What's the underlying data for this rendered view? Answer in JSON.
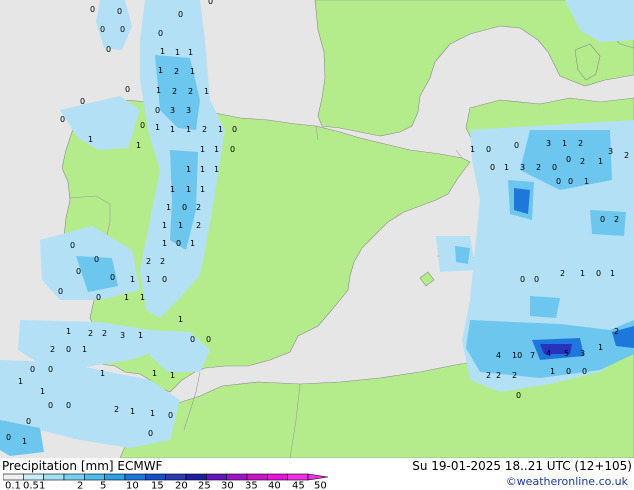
{
  "map": {
    "colors": {
      "sea": "#e6e6e6",
      "land_model": "#b4ec8c",
      "land_outside": "#f2f2f2",
      "border": "#a0a0a0",
      "precip_light": "#b3e0f5",
      "precip_mid": "#6cc6ee",
      "precip_high": "#1e78dc",
      "precip_peak": "#2832be"
    },
    "station_values": [
      {
        "v": "0"
      },
      {
        "v": "0"
      },
      {
        "v": "0"
      },
      {
        "v": "0"
      },
      {
        "v": "0"
      },
      {
        "v": "0"
      },
      {
        "v": "0"
      },
      {
        "v": "0"
      },
      {
        "v": "1"
      },
      {
        "v": "1"
      },
      {
        "v": "1"
      },
      {
        "v": "1"
      },
      {
        "v": "2"
      },
      {
        "v": "1"
      },
      {
        "v": "1"
      },
      {
        "v": "2"
      },
      {
        "v": "2"
      },
      {
        "v": "1"
      },
      {
        "v": "0"
      },
      {
        "v": "3"
      },
      {
        "v": "3"
      },
      {
        "v": "0"
      },
      {
        "v": "2"
      },
      {
        "v": "1"
      },
      {
        "v": "1"
      },
      {
        "v": "1"
      },
      {
        "v": "1"
      },
      {
        "v": "0"
      },
      {
        "v": "0"
      },
      {
        "v": "1"
      },
      {
        "v": "1"
      },
      {
        "v": "0"
      },
      {
        "v": "1"
      },
      {
        "v": "1"
      },
      {
        "v": "1"
      },
      {
        "v": "1"
      },
      {
        "v": "1"
      },
      {
        "v": "1"
      },
      {
        "v": "1"
      },
      {
        "v": "0"
      },
      {
        "v": "0"
      },
      {
        "v": "0"
      },
      {
        "v": "1"
      },
      {
        "v": "1"
      },
      {
        "v": "2"
      },
      {
        "v": "1"
      },
      {
        "v": "1"
      },
      {
        "v": "2"
      },
      {
        "v": "1"
      },
      {
        "v": "0"
      },
      {
        "v": "1"
      },
      {
        "v": "2"
      },
      {
        "v": "2"
      },
      {
        "v": "1"
      },
      {
        "v": "1"
      },
      {
        "v": "0"
      },
      {
        "v": "0"
      },
      {
        "v": "0"
      },
      {
        "v": "0"
      },
      {
        "v": "0"
      },
      {
        "v": "1"
      },
      {
        "v": "1"
      },
      {
        "v": "0"
      },
      {
        "v": "0"
      },
      {
        "v": "1"
      },
      {
        "v": "2"
      },
      {
        "v": "2"
      },
      {
        "v": "3"
      },
      {
        "v": "1"
      },
      {
        "v": "2"
      },
      {
        "v": "0"
      },
      {
        "v": "1"
      },
      {
        "v": "1"
      },
      {
        "v": "0"
      },
      {
        "v": "0"
      },
      {
        "v": "0"
      },
      {
        "v": "0"
      },
      {
        "v": "1"
      },
      {
        "v": "1"
      },
      {
        "v": "1"
      },
      {
        "v": "1"
      },
      {
        "v": "1"
      },
      {
        "v": "0"
      },
      {
        "v": "0"
      },
      {
        "v": "2"
      },
      {
        "v": "1"
      },
      {
        "v": "1"
      },
      {
        "v": "0"
      },
      {
        "v": "0"
      },
      {
        "v": "0"
      },
      {
        "v": "0"
      },
      {
        "v": "1"
      },
      {
        "v": "1"
      },
      {
        "v": "0"
      },
      {
        "v": "0"
      },
      {
        "v": "3"
      },
      {
        "v": "1"
      },
      {
        "v": "2"
      },
      {
        "v": "0"
      },
      {
        "v": "1"
      },
      {
        "v": "3"
      },
      {
        "v": "2"
      },
      {
        "v": "0"
      },
      {
        "v": "0"
      },
      {
        "v": "4"
      },
      {
        "v": "10"
      },
      {
        "v": "7"
      },
      {
        "v": "4"
      },
      {
        "v": "5"
      },
      {
        "v": "3"
      },
      {
        "v": "2"
      },
      {
        "v": "2"
      },
      {
        "v": "2"
      },
      {
        "v": "0"
      },
      {
        "v": "1"
      },
      {
        "v": "0"
      },
      {
        "v": "0"
      },
      {
        "v": "1"
      },
      {
        "v": "2"
      },
      {
        "v": "2"
      },
      {
        "v": "3"
      },
      {
        "v": "2"
      },
      {
        "v": "1"
      },
      {
        "v": "0"
      },
      {
        "v": "0"
      },
      {
        "v": "1"
      },
      {
        "v": "0"
      },
      {
        "v": "2"
      },
      {
        "v": "1"
      },
      {
        "v": "0"
      },
      {
        "v": "1"
      },
      {
        "v": "2"
      },
      {
        "v": "0"
      },
      {
        "v": "0"
      }
    ]
  },
  "footer": {
    "title_left": "Precipitation [mm]  ECMWF",
    "title_right": "Su 19-01-2025 18..21 UTC (12+105)",
    "credit": "©weatheronline.co.uk"
  },
  "legend": {
    "colors": [
      "#f0f0f0",
      "#c8eefa",
      "#a0e0f5",
      "#78d0f0",
      "#50bcec",
      "#30a0e6",
      "#1e78dc",
      "#1450c8",
      "#283cb4",
      "#1e1ea0",
      "#6414be",
      "#a014c8",
      "#c814c8",
      "#e614dc",
      "#f030e6"
    ],
    "ticks": [
      "0.1",
      "0.5",
      "1",
      "2",
      "5",
      "10",
      "15",
      "20",
      "25",
      "30",
      "35",
      "40",
      "45",
      "50"
    ]
  }
}
